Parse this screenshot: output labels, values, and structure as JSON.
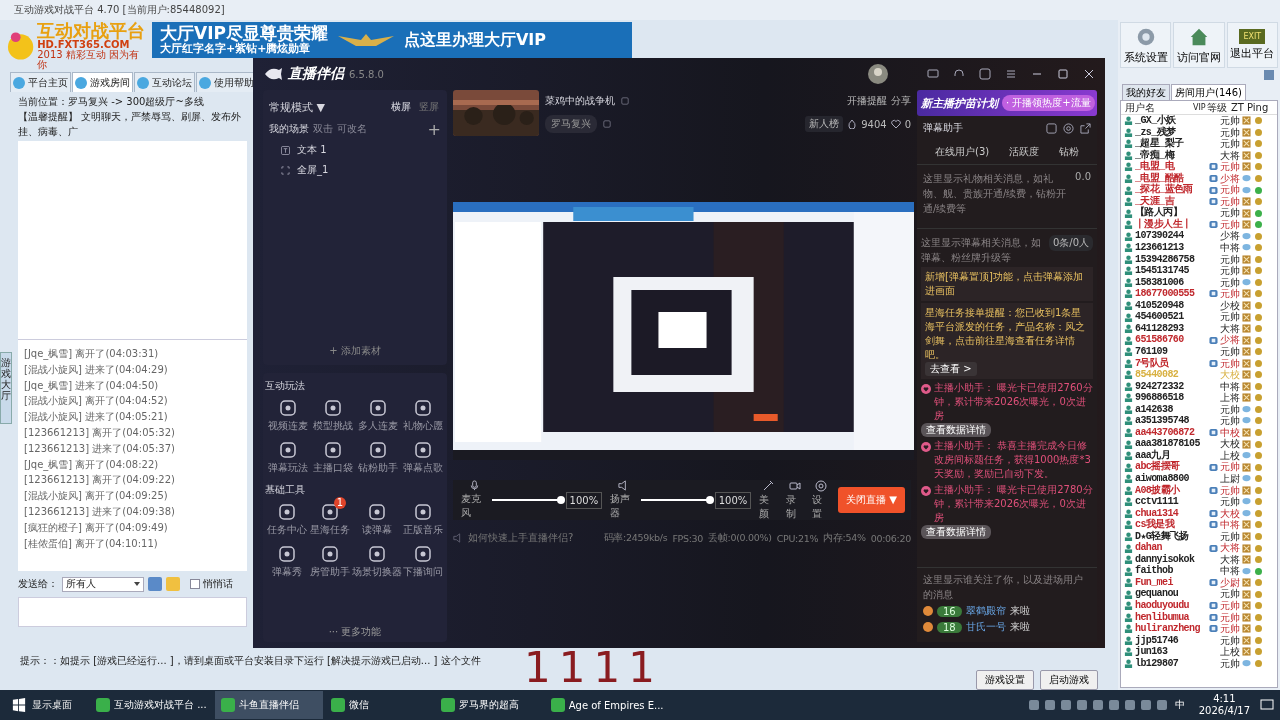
{
  "platform": {
    "title": "互动游戏对战平台 4.70 [当前用户:85448092]",
    "logo": {
      "name": "互动对战平台",
      "site": "HD.FXT365.COM",
      "slogan": "2013 精彩互动 因为有你"
    },
    "banner": {
      "line1": "大厅VIP尽显尊贵荣耀",
      "line2": "大厅红字名字+紫钻+腾炫勋章",
      "cta": "点这里办理大厅VIP"
    },
    "tabs": [
      {
        "label": "平台主页",
        "selected": false
      },
      {
        "label": "游戏房间",
        "selected": true
      },
      {
        "label": "互动论坛",
        "selected": false
      },
      {
        "label": "使用帮助",
        "selected": false
      }
    ],
    "location": "当前位置：罗马复兴 -> 300超级厅~多线",
    "notice": "【温馨提醒】 文明聊天，严禁辱骂、刷屏、发布外挂、病毒、广",
    "side_tab": "游戏大厅",
    "chat": [
      "[Jqe_枫雪] 离开了(04:03:31)",
      "[混战小旋风] 进来了(04:04:29)",
      "[Jqe_枫雪] 进来了(04:04:50)",
      "[混战小旋风] 离开了(04:04:52)",
      "[混战小旋风] 进来了(04:05:21)",
      "[123661213] 离开了(04:05:32)",
      "[123661213] 进来了(04:05:37)",
      "[Jqe_枫雪] 离开了(04:08:22)",
      "[123661213] 离开了(04:09:22)",
      "[混战小旋风] 离开了(04:09:25)",
      "[123661213] 进来了(04:09:38)",
      "[疯狂的橙子] 离开了(04:09:49)",
      "[桂侬蛋伯] 离开了(04:10:11)"
    ],
    "send_to_label": "发送给：",
    "send_to": "所有人",
    "whisper": {
      "label": "悄悄话",
      "checked": false
    },
    "hint": "提示：：如提示 [游戏已经运行... ]，请到桌面或平台安装目录下运行 [解决提示游戏已启动... ] 这个文件",
    "buttons": [
      "游戏设置",
      "启动游戏"
    ]
  },
  "toolbar": [
    "系统设置",
    "访问官网",
    "退出平台"
  ],
  "exit_key": "EXIT",
  "user_tabs": [
    {
      "label": "我的好友",
      "selected": false
    },
    {
      "label": "房间用户(146)",
      "selected": true
    }
  ],
  "user_columns": [
    "用户名",
    "VIP",
    "等级",
    "ZT",
    "Ping"
  ],
  "users": [
    {
      "name": "_GX_小妖",
      "vip": false,
      "rank": "元帅",
      "color": "#222222",
      "kind": "busy",
      "ping_good": false
    },
    {
      "name": "_zs_残梦",
      "vip": false,
      "rank": "元帅",
      "color": "#222222",
      "kind": "busy",
      "ping_good": false
    },
    {
      "name": "_超星_梨子",
      "vip": false,
      "rank": "元帅",
      "color": "#222222",
      "kind": "busy",
      "ping_good": false
    },
    {
      "name": "_帝痴_梅",
      "vip": false,
      "rank": "大将",
      "color": "#222222",
      "kind": "busy",
      "ping_good": false
    },
    {
      "name": "_电盟_电",
      "vip": true,
      "rank": "元帅",
      "color": "#c0282d",
      "kind": "busy",
      "ping_good": false
    },
    {
      "name": "_电盟_酷酷",
      "vip": true,
      "rank": "少将",
      "color": "#c0282d",
      "kind": "chat",
      "ping_good": false
    },
    {
      "name": "_探花_蓝色雨",
      "vip": true,
      "rank": "元帅",
      "color": "#c0282d",
      "kind": "chat",
      "ping_good": true
    },
    {
      "name": "_天涯_吉",
      "vip": true,
      "rank": "元帅",
      "color": "#c0282d",
      "kind": "busy",
      "ping_good": false
    },
    {
      "name": "【路人丙】",
      "vip": false,
      "rank": "元帅",
      "color": "#222222",
      "kind": "busy",
      "ping_good": true
    },
    {
      "name": "丨漫步人生丨",
      "vip": true,
      "rank": "元帅",
      "color": "#c0282d",
      "kind": "busy",
      "ping_good": true
    },
    {
      "name": "107390244",
      "vip": false,
      "rank": "少将",
      "color": "#222222",
      "kind": "chat",
      "ping_good": false
    },
    {
      "name": "123661213",
      "vip": false,
      "rank": "中将",
      "color": "#222222",
      "kind": "chat",
      "ping_good": false
    },
    {
      "name": "15394286758",
      "vip": false,
      "rank": "元帅",
      "color": "#222222",
      "kind": "busy",
      "ping_good": false
    },
    {
      "name": "1545131745",
      "vip": false,
      "rank": "元帅",
      "color": "#222222",
      "kind": "busy",
      "ping_good": false
    },
    {
      "name": "158381006",
      "vip": false,
      "rank": "元帅",
      "color": "#222222",
      "kind": "chat",
      "ping_good": false
    },
    {
      "name": "18677000555",
      "vip": true,
      "rank": "元帅",
      "color": "#c0282d",
      "kind": "busy",
      "ping_good": false
    },
    {
      "name": "410520948",
      "vip": false,
      "rank": "少校",
      "color": "#222222",
      "kind": "busy",
      "ping_good": false
    },
    {
      "name": "454600521",
      "vip": false,
      "rank": "元帅",
      "color": "#222222",
      "kind": "busy",
      "ping_good": false
    },
    {
      "name": "641128293",
      "vip": false,
      "rank": "大将",
      "color": "#222222",
      "kind": "busy",
      "ping_good": false
    },
    {
      "name": "651586760",
      "vip": true,
      "rank": "少将",
      "color": "#c0282d",
      "kind": "busy",
      "ping_good": false
    },
    {
      "name": "761109",
      "vip": false,
      "rank": "元帅",
      "color": "#222222",
      "kind": "busy",
      "ping_good": false
    },
    {
      "name": "7号队员",
      "vip": true,
      "rank": "元帅",
      "color": "#c0282d",
      "kind": "busy",
      "ping_good": false
    },
    {
      "name": "85440082",
      "vip": false,
      "rank": "大校",
      "color": "#d8b040",
      "kind": "busy",
      "ping_good": false
    },
    {
      "name": "924272332",
      "vip": false,
      "rank": "中将",
      "color": "#222222",
      "kind": "busy",
      "ping_good": false
    },
    {
      "name": "996886518",
      "vip": false,
      "rank": "上将",
      "color": "#222222",
      "kind": "busy",
      "ping_good": false
    },
    {
      "name": "a142638",
      "vip": false,
      "rank": "元帅",
      "color": "#222222",
      "kind": "chat",
      "ping_good": false
    },
    {
      "name": "a351395748",
      "vip": false,
      "rank": "元帅",
      "color": "#222222",
      "kind": "chat",
      "ping_good": false
    },
    {
      "name": "aa443706872",
      "vip": true,
      "rank": "中校",
      "color": "#c0282d",
      "kind": "busy",
      "ping_good": false
    },
    {
      "name": "aaa381878105",
      "vip": false,
      "rank": "大校",
      "color": "#222222",
      "kind": "busy",
      "ping_good": false
    },
    {
      "name": "aaa九月",
      "vip": false,
      "rank": "上校",
      "color": "#222222",
      "kind": "chat",
      "ping_good": false
    },
    {
      "name": "abc摇摆哥",
      "vip": true,
      "rank": "元帅",
      "color": "#c0282d",
      "kind": "busy",
      "ping_good": false
    },
    {
      "name": "aiwoma8800",
      "vip": false,
      "rank": "上尉",
      "color": "#222222",
      "kind": "chat",
      "ping_good": false
    },
    {
      "name": "A08披霸小",
      "vip": true,
      "rank": "元帅",
      "color": "#c0282d",
      "kind": "busy",
      "ping_good": false
    },
    {
      "name": "cctv1111",
      "vip": false,
      "rank": "元帅",
      "color": "#222222",
      "kind": "chat",
      "ping_good": false
    },
    {
      "name": "chua1314",
      "vip": true,
      "rank": "大校",
      "color": "#c0282d",
      "kind": "chat",
      "ping_good": false
    },
    {
      "name": "cs我是我",
      "vip": true,
      "rank": "中将",
      "color": "#c0282d",
      "kind": "busy",
      "ping_good": false
    },
    {
      "name": "D★G轻舞飞扬",
      "vip": false,
      "rank": "元帅",
      "color": "#222222",
      "kind": "busy",
      "ping_good": false
    },
    {
      "name": "dahan",
      "vip": true,
      "rank": "大将",
      "color": "#c0282d",
      "kind": "busy",
      "ping_good": false
    },
    {
      "name": "dannyisokok",
      "vip": false,
      "rank": "大将",
      "color": "#222222",
      "kind": "busy",
      "ping_good": false
    },
    {
      "name": "faithob",
      "vip": false,
      "rank": "中将",
      "color": "#222222",
      "kind": "chat",
      "ping_good": true
    },
    {
      "name": "Fun_mei",
      "vip": true,
      "rank": "少尉",
      "color": "#c0282d",
      "kind": "busy",
      "ping_good": false
    },
    {
      "name": "gequanou",
      "vip": false,
      "rank": "元帅",
      "color": "#222222",
      "kind": "busy",
      "ping_good": false
    },
    {
      "name": "haoduyoudu",
      "vip": true,
      "rank": "元帅",
      "color": "#c0282d",
      "kind": "busy",
      "ping_good": false
    },
    {
      "name": "henlibumua",
      "vip": true,
      "rank": "元帅",
      "color": "#c0282d",
      "kind": "busy",
      "ping_good": false
    },
    {
      "name": "huliranzheng",
      "vip": true,
      "rank": "元帅",
      "color": "#c0282d",
      "kind": "busy",
      "ping_good": false
    },
    {
      "name": "jjp51746",
      "vip": false,
      "rank": "元帅",
      "color": "#222222",
      "kind": "busy",
      "ping_good": false
    },
    {
      "name": "jun163",
      "vip": false,
      "rank": "上校",
      "color": "#222222",
      "kind": "busy",
      "ping_good": false
    },
    {
      "name": "lb129807",
      "vip": false,
      "rank": "元帅",
      "color": "#222222",
      "kind": "chat",
      "ping_good": false
    }
  ],
  "stream": {
    "app_name": "直播伴侣",
    "version": "6.5.8.0",
    "mode": "常规模式 ▼",
    "orientation": [
      {
        "label": "横屏",
        "selected": true
      },
      {
        "label": "竖屏",
        "selected": false
      }
    ],
    "scenes_title": "我的场景",
    "scenes_hint": [
      "双击",
      "可改名"
    ],
    "add_scene": "+",
    "scenes": [
      {
        "label": "文本 1",
        "kind": "text"
      },
      {
        "label": "全屏_1",
        "kind": "screen"
      }
    ],
    "add_source": "+ 添加素材",
    "sections": [
      {
        "title": "互动玩法",
        "tools": [
          {
            "label": "视频连麦"
          },
          {
            "label": "模型挑战"
          },
          {
            "label": "多人连麦"
          },
          {
            "label": "礼物心愿"
          },
          {
            "label": "弹幕玩法"
          },
          {
            "label": "主播口袋"
          },
          {
            "label": "钻粉助手"
          },
          {
            "label": "弹幕点歌"
          }
        ]
      },
      {
        "title": "基础工具",
        "tools": [
          {
            "label": "任务中心"
          },
          {
            "label": "星海任务",
            "badge": "1"
          },
          {
            "label": "读弹幕"
          },
          {
            "label": "正版音乐"
          },
          {
            "label": "弹幕秀"
          },
          {
            "label": "房管助手"
          },
          {
            "label": "场景切换器"
          },
          {
            "label": "下播询问"
          }
        ]
      }
    ],
    "more": "··· 更多功能",
    "room_title": "菜鸡中的战争机",
    "category": "罗马复兴",
    "remind": "开播提醒",
    "share": "分享",
    "rank_board": "新人榜",
    "heat": "9404",
    "likes": "0",
    "audio": [
      {
        "label": "麦克风",
        "level": 1,
        "reading": "100%"
      },
      {
        "label": "扬声器",
        "level": 1,
        "reading": "100%"
      }
    ],
    "actions": [
      "美颜",
      "录制",
      "设置"
    ],
    "stop": "关闭直播 ▼",
    "help": "如何快速上手直播伴侣?",
    "stats": [
      "码率:2459kb/s",
      "FPS:30",
      "丢帧:0(0.00%)",
      "CPU:21%",
      "内存:54%",
      "00:06:20"
    ],
    "promo": {
      "title": "新主播护苗计划",
      "tag": "· 开播领热度+流量"
    },
    "assistant": "弹幕助手",
    "tabs": [
      "在线用户(3)",
      "活跃度",
      "钻粉"
    ],
    "gift_placeholder": "这里显示礼物相关消息，如礼物、舰、贵族开通/续费，钻粉开通/续费等",
    "gift_total": "0.0",
    "danmu_placeholder": "这里显示弹幕相关消息，如弹幕、粉丝牌升级等",
    "danmu_count": "0条/0人",
    "messages": [
      {
        "kind": "notice",
        "text": "新增[弹幕置顶]功能，点击弹幕添加进画面"
      },
      {
        "kind": "notice",
        "text": "星海任务接单提醒：您已收到1条星海平台派发的任务，产品名称：风之剑舞，点击前往星海查看任务详情吧。",
        "button": "去查看 >"
      },
      {
        "kind": "assistant",
        "text": "主播小助手：  曝光卡已使用2760分钟，累计带来2026次曝光，0次进房",
        "button": "查看数据详情"
      },
      {
        "kind": "assistant",
        "text": "主播小助手：  恭喜主播完成今日修改房间标题任务，获得1000热度*3天奖励，奖励已自动下发。"
      },
      {
        "kind": "assistant",
        "text": "主播小助手：  曝光卡已使用2780分钟，累计带来2026次曝光，0次进房",
        "button": "查看数据详情"
      }
    ],
    "follow_placeholder": "这里显示谁关注了你，以及进场用户的消息",
    "entrants": [
      {
        "level": "16",
        "name": "翠鹤殿帘",
        "action": "来啦"
      },
      {
        "level": "18",
        "name": "甘氏一号",
        "action": "来啦"
      }
    ]
  },
  "overlay_text": "1111",
  "taskbar": {
    "desktop": "显示桌面",
    "apps": [
      {
        "label": "互动游戏对战平台 ...",
        "selected": false
      },
      {
        "label": "斗鱼直播伴侣",
        "selected": true
      },
      {
        "label": "微信",
        "selected": false
      },
      {
        "label": "罗马界的超高",
        "selected": false
      },
      {
        "label": "Age of Empires E...",
        "selected": false
      }
    ],
    "ime": "中",
    "time": "4:11",
    "date": "2026/4/17"
  }
}
